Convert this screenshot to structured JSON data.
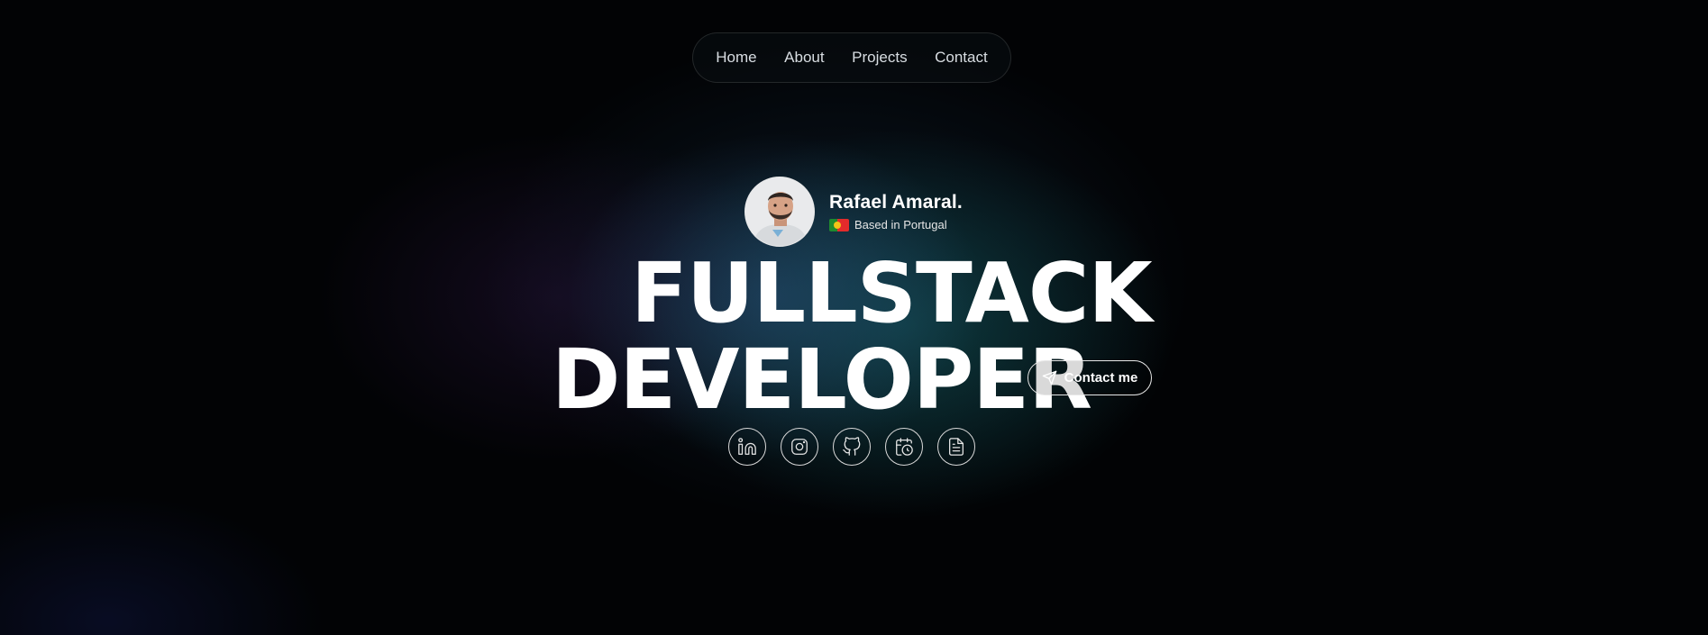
{
  "nav": {
    "items": [
      {
        "label": "Home"
      },
      {
        "label": "About"
      },
      {
        "label": "Projects"
      },
      {
        "label": "Contact"
      }
    ]
  },
  "profile": {
    "name": "Rafael Amaral.",
    "location": "Based in Portugal",
    "flag_icon": "portugal-flag-icon"
  },
  "hero": {
    "line1": "FULLSTACK",
    "line2": "DEVELOPER",
    "contact_label": "Contact me",
    "contact_icon": "send-icon"
  },
  "socials": [
    {
      "icon": "linkedin-icon"
    },
    {
      "icon": "instagram-icon"
    },
    {
      "icon": "github-icon"
    },
    {
      "icon": "calendar-clock-icon"
    },
    {
      "icon": "document-icon"
    }
  ],
  "colors": {
    "background": "#020305",
    "text": "#ffffff",
    "glow_teal": "#146e6e",
    "glow_blue": "#285078"
  }
}
